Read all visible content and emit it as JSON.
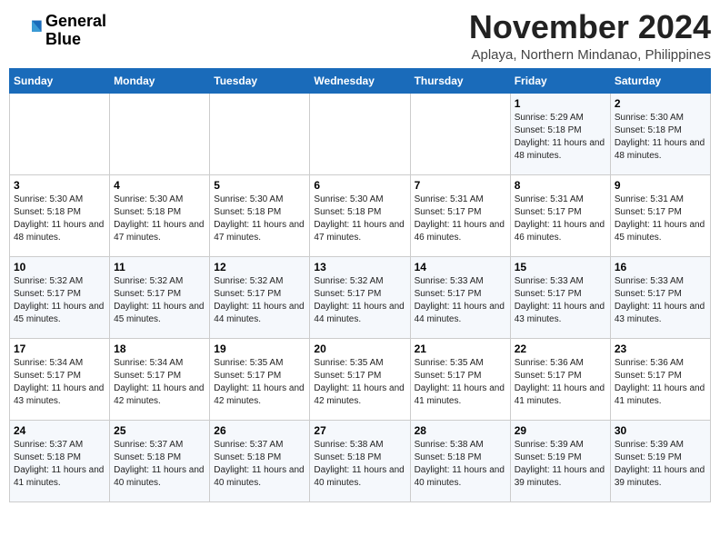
{
  "header": {
    "logo_line1": "General",
    "logo_line2": "Blue",
    "month_title": "November 2024",
    "location": "Aplaya, Northern Mindanao, Philippines"
  },
  "days_of_week": [
    "Sunday",
    "Monday",
    "Tuesday",
    "Wednesday",
    "Thursday",
    "Friday",
    "Saturday"
  ],
  "weeks": [
    [
      {
        "day": "",
        "sunrise": "",
        "sunset": "",
        "daylight": ""
      },
      {
        "day": "",
        "sunrise": "",
        "sunset": "",
        "daylight": ""
      },
      {
        "day": "",
        "sunrise": "",
        "sunset": "",
        "daylight": ""
      },
      {
        "day": "",
        "sunrise": "",
        "sunset": "",
        "daylight": ""
      },
      {
        "day": "",
        "sunrise": "",
        "sunset": "",
        "daylight": ""
      },
      {
        "day": "1",
        "sunrise": "5:29 AM",
        "sunset": "5:18 PM",
        "daylight": "11 hours and 48 minutes."
      },
      {
        "day": "2",
        "sunrise": "5:30 AM",
        "sunset": "5:18 PM",
        "daylight": "11 hours and 48 minutes."
      }
    ],
    [
      {
        "day": "3",
        "sunrise": "5:30 AM",
        "sunset": "5:18 PM",
        "daylight": "11 hours and 48 minutes."
      },
      {
        "day": "4",
        "sunrise": "5:30 AM",
        "sunset": "5:18 PM",
        "daylight": "11 hours and 47 minutes."
      },
      {
        "day": "5",
        "sunrise": "5:30 AM",
        "sunset": "5:18 PM",
        "daylight": "11 hours and 47 minutes."
      },
      {
        "day": "6",
        "sunrise": "5:30 AM",
        "sunset": "5:18 PM",
        "daylight": "11 hours and 47 minutes."
      },
      {
        "day": "7",
        "sunrise": "5:31 AM",
        "sunset": "5:17 PM",
        "daylight": "11 hours and 46 minutes."
      },
      {
        "day": "8",
        "sunrise": "5:31 AM",
        "sunset": "5:17 PM",
        "daylight": "11 hours and 46 minutes."
      },
      {
        "day": "9",
        "sunrise": "5:31 AM",
        "sunset": "5:17 PM",
        "daylight": "11 hours and 45 minutes."
      }
    ],
    [
      {
        "day": "10",
        "sunrise": "5:32 AM",
        "sunset": "5:17 PM",
        "daylight": "11 hours and 45 minutes."
      },
      {
        "day": "11",
        "sunrise": "5:32 AM",
        "sunset": "5:17 PM",
        "daylight": "11 hours and 45 minutes."
      },
      {
        "day": "12",
        "sunrise": "5:32 AM",
        "sunset": "5:17 PM",
        "daylight": "11 hours and 44 minutes."
      },
      {
        "day": "13",
        "sunrise": "5:32 AM",
        "sunset": "5:17 PM",
        "daylight": "11 hours and 44 minutes."
      },
      {
        "day": "14",
        "sunrise": "5:33 AM",
        "sunset": "5:17 PM",
        "daylight": "11 hours and 44 minutes."
      },
      {
        "day": "15",
        "sunrise": "5:33 AM",
        "sunset": "5:17 PM",
        "daylight": "11 hours and 43 minutes."
      },
      {
        "day": "16",
        "sunrise": "5:33 AM",
        "sunset": "5:17 PM",
        "daylight": "11 hours and 43 minutes."
      }
    ],
    [
      {
        "day": "17",
        "sunrise": "5:34 AM",
        "sunset": "5:17 PM",
        "daylight": "11 hours and 43 minutes."
      },
      {
        "day": "18",
        "sunrise": "5:34 AM",
        "sunset": "5:17 PM",
        "daylight": "11 hours and 42 minutes."
      },
      {
        "day": "19",
        "sunrise": "5:35 AM",
        "sunset": "5:17 PM",
        "daylight": "11 hours and 42 minutes."
      },
      {
        "day": "20",
        "sunrise": "5:35 AM",
        "sunset": "5:17 PM",
        "daylight": "11 hours and 42 minutes."
      },
      {
        "day": "21",
        "sunrise": "5:35 AM",
        "sunset": "5:17 PM",
        "daylight": "11 hours and 41 minutes."
      },
      {
        "day": "22",
        "sunrise": "5:36 AM",
        "sunset": "5:17 PM",
        "daylight": "11 hours and 41 minutes."
      },
      {
        "day": "23",
        "sunrise": "5:36 AM",
        "sunset": "5:17 PM",
        "daylight": "11 hours and 41 minutes."
      }
    ],
    [
      {
        "day": "24",
        "sunrise": "5:37 AM",
        "sunset": "5:18 PM",
        "daylight": "11 hours and 41 minutes."
      },
      {
        "day": "25",
        "sunrise": "5:37 AM",
        "sunset": "5:18 PM",
        "daylight": "11 hours and 40 minutes."
      },
      {
        "day": "26",
        "sunrise": "5:37 AM",
        "sunset": "5:18 PM",
        "daylight": "11 hours and 40 minutes."
      },
      {
        "day": "27",
        "sunrise": "5:38 AM",
        "sunset": "5:18 PM",
        "daylight": "11 hours and 40 minutes."
      },
      {
        "day": "28",
        "sunrise": "5:38 AM",
        "sunset": "5:18 PM",
        "daylight": "11 hours and 40 minutes."
      },
      {
        "day": "29",
        "sunrise": "5:39 AM",
        "sunset": "5:19 PM",
        "daylight": "11 hours and 39 minutes."
      },
      {
        "day": "30",
        "sunrise": "5:39 AM",
        "sunset": "5:19 PM",
        "daylight": "11 hours and 39 minutes."
      }
    ]
  ]
}
